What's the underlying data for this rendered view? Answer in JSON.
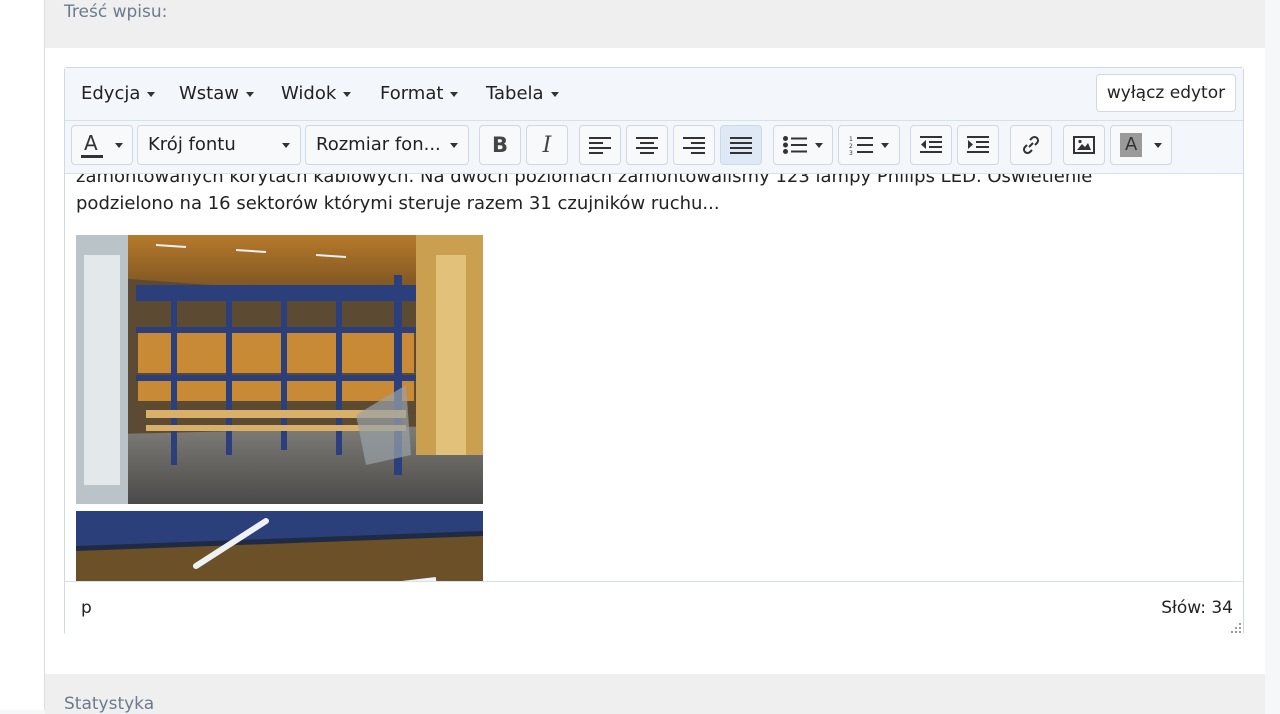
{
  "panel": {
    "title": "Treść wpisu:"
  },
  "menubar": {
    "items": [
      "Edycja",
      "Wstaw",
      "Widok",
      "Format",
      "Tabela"
    ],
    "disable_editor": "wyłącz edytor"
  },
  "toolbar": {
    "font_family": "Krój fontu",
    "font_size": "Rozmiar fon...",
    "text_color_icon": "A",
    "bold": "B",
    "italic": "I",
    "bg_color_icon": "A"
  },
  "content": {
    "line1": "zamontowanych korytach kablowych. Na dwóch poziomach zamontowaliśmy 123 lampy Philips LED. Oświetlenie",
    "line2": "podzielono na 16 sektorów którymi steruje razem 31 czujników ruchu..."
  },
  "statusbar": {
    "path": "p",
    "word_count": "Słów: 34"
  },
  "next_section": {
    "title": "Statystyka"
  },
  "colors": {
    "accent": "#cfd8e3",
    "toolbar_bg": "#f3f7fb",
    "active_bg": "#dfe9f5"
  }
}
